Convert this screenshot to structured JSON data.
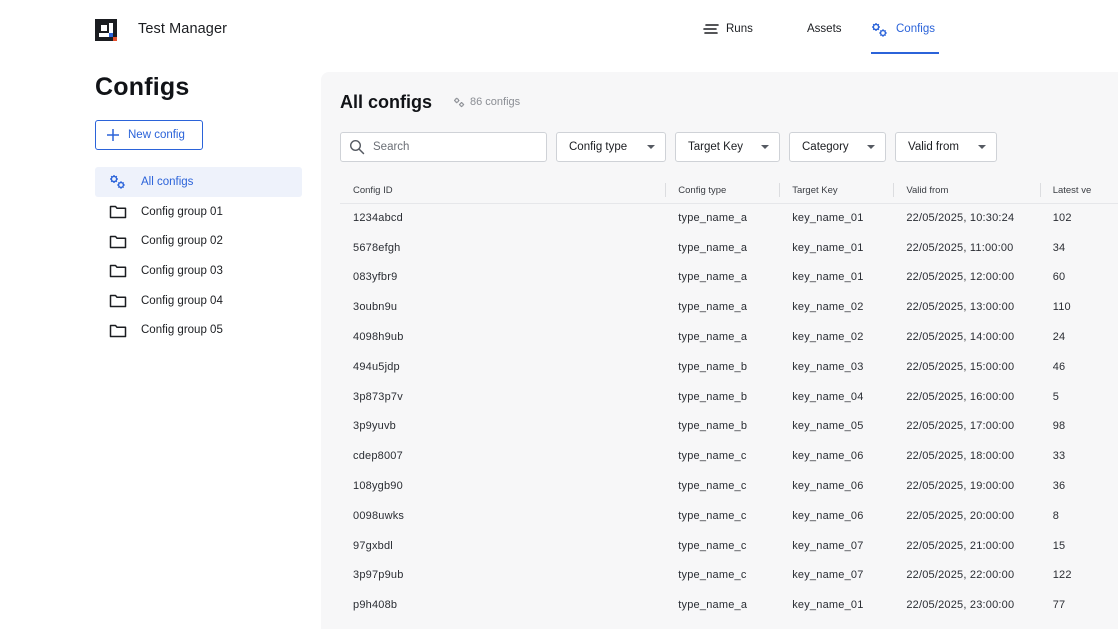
{
  "app": {
    "title": "Test Manager"
  },
  "nav": {
    "runs": "Runs",
    "assets": "Assets",
    "configs": "Configs"
  },
  "sidebar": {
    "title": "Configs",
    "new_button": "New config",
    "items": [
      {
        "label": "All configs",
        "icon": "gears-icon"
      },
      {
        "label": "Config group 01",
        "icon": "folder-icon"
      },
      {
        "label": "Config group 02",
        "icon": "folder-icon"
      },
      {
        "label": "Config group 03",
        "icon": "folder-icon"
      },
      {
        "label": "Config group 04",
        "icon": "folder-icon"
      },
      {
        "label": "Config group 05",
        "icon": "folder-icon"
      }
    ]
  },
  "main": {
    "title": "All configs",
    "count": "86 configs",
    "search_placeholder": "Search",
    "filters": [
      "Config type",
      "Target Key",
      "Category",
      "Valid from"
    ]
  },
  "table": {
    "columns": [
      "Config ID",
      "Config type",
      "Target Key",
      "Valid from",
      "Latest ve"
    ],
    "rows": [
      [
        "1234abcd",
        "type_name_a",
        "key_name_01",
        "22/05/2025, 10:30:24",
        "102"
      ],
      [
        "5678efgh",
        "type_name_a",
        "key_name_01",
        "22/05/2025, 11:00:00",
        "34"
      ],
      [
        "083yfbr9",
        "type_name_a",
        "key_name_01",
        "22/05/2025, 12:00:00",
        "60"
      ],
      [
        "3oubn9u",
        "type_name_a",
        "key_name_02",
        "22/05/2025, 13:00:00",
        "110"
      ],
      [
        "4098h9ub",
        "type_name_a",
        "key_name_02",
        "22/05/2025, 14:00:00",
        "24"
      ],
      [
        "494u5jdp",
        "type_name_b",
        "key_name_03",
        "22/05/2025, 15:00:00",
        "46"
      ],
      [
        "3p873p7v",
        "type_name_b",
        "key_name_04",
        "22/05/2025, 16:00:00",
        "5"
      ],
      [
        "3p9yuvb",
        "type_name_b",
        "key_name_05",
        "22/05/2025, 17:00:00",
        "98"
      ],
      [
        "cdep8007",
        "type_name_c",
        "key_name_06",
        "22/05/2025, 18:00:00",
        "33"
      ],
      [
        "108ygb90",
        "type_name_c",
        "key_name_06",
        "22/05/2025, 19:00:00",
        "36"
      ],
      [
        "0098uwks",
        "type_name_c",
        "key_name_06",
        "22/05/2025, 20:00:00",
        "8"
      ],
      [
        "97gxbdl",
        "type_name_c",
        "key_name_07",
        "22/05/2025, 21:00:00",
        "15"
      ],
      [
        "3p97p9ub",
        "type_name_c",
        "key_name_07",
        "22/05/2025, 22:00:00",
        "122"
      ],
      [
        "p9h408b",
        "type_name_a",
        "key_name_01",
        "22/05/2025, 23:00:00",
        "77"
      ]
    ]
  },
  "colors": {
    "accent": "#2b63d9",
    "logo_dot": "#e8502e"
  }
}
